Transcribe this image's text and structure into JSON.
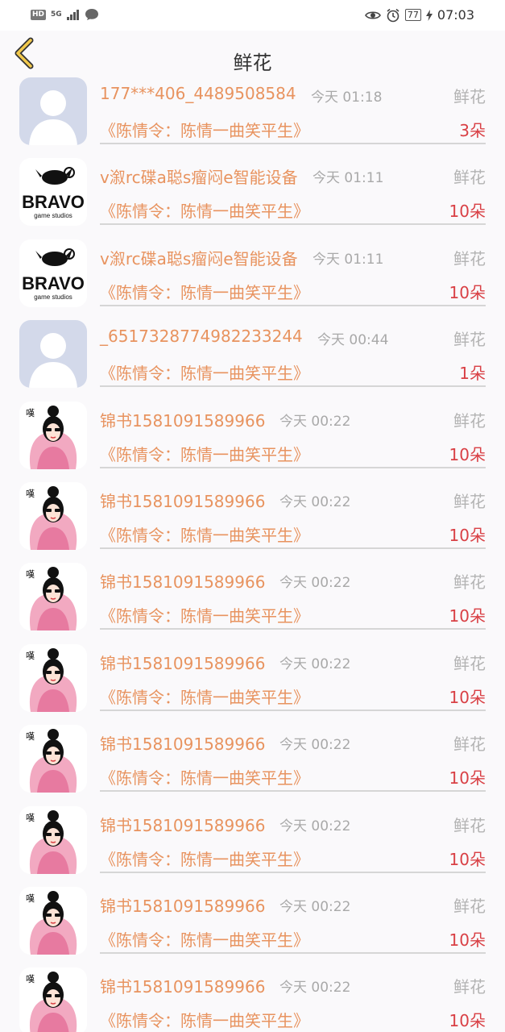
{
  "status_bar": {
    "hd": "HD",
    "network": "5G",
    "battery": "77",
    "time": "07:03"
  },
  "header": {
    "title": "鲜花"
  },
  "rows": [
    {
      "avatar": "default",
      "name": "177***406_4489508584",
      "time": "今天 01:18",
      "gift": "鲜花",
      "drama": "《陈情令：陈情一曲笑平生》",
      "count": "3朵"
    },
    {
      "avatar": "bravo",
      "name": "v溆rc碟a聪s瘤闷e智能设备",
      "time": "今天 01:11",
      "gift": "鲜花",
      "drama": "《陈情令：陈情一曲笑平生》",
      "count": "10朵"
    },
    {
      "avatar": "bravo",
      "name": "v溆rc碟a聪s瘤闷e智能设备",
      "time": "今天 01:11",
      "gift": "鲜花",
      "drama": "《陈情令：陈情一曲笑平生》",
      "count": "10朵"
    },
    {
      "avatar": "default",
      "name": "_6517328774982233244",
      "time": "今天 00:44",
      "gift": "鲜花",
      "drama": "《陈情令：陈情一曲笑平生》",
      "count": "1朵"
    },
    {
      "avatar": "girl",
      "name": "锦书1581091589966",
      "time": "今天 00:22",
      "gift": "鲜花",
      "drama": "《陈情令：陈情一曲笑平生》",
      "count": "10朵"
    },
    {
      "avatar": "girl",
      "name": "锦书1581091589966",
      "time": "今天 00:22",
      "gift": "鲜花",
      "drama": "《陈情令：陈情一曲笑平生》",
      "count": "10朵"
    },
    {
      "avatar": "girl",
      "name": "锦书1581091589966",
      "time": "今天 00:22",
      "gift": "鲜花",
      "drama": "《陈情令：陈情一曲笑平生》",
      "count": "10朵"
    },
    {
      "avatar": "girl",
      "name": "锦书1581091589966",
      "time": "今天 00:22",
      "gift": "鲜花",
      "drama": "《陈情令：陈情一曲笑平生》",
      "count": "10朵"
    },
    {
      "avatar": "girl",
      "name": "锦书1581091589966",
      "time": "今天 00:22",
      "gift": "鲜花",
      "drama": "《陈情令：陈情一曲笑平生》",
      "count": "10朵"
    },
    {
      "avatar": "girl",
      "name": "锦书1581091589966",
      "time": "今天 00:22",
      "gift": "鲜花",
      "drama": "《陈情令：陈情一曲笑平生》",
      "count": "10朵"
    },
    {
      "avatar": "girl",
      "name": "锦书1581091589966",
      "time": "今天 00:22",
      "gift": "鲜花",
      "drama": "《陈情令：陈情一曲笑平生》",
      "count": "10朵"
    },
    {
      "avatar": "girl",
      "name": "锦书1581091589966",
      "time": "今天 00:22",
      "gift": "鲜花",
      "drama": "《陈情令：陈情一曲笑平生》",
      "count": "10朵"
    }
  ]
}
